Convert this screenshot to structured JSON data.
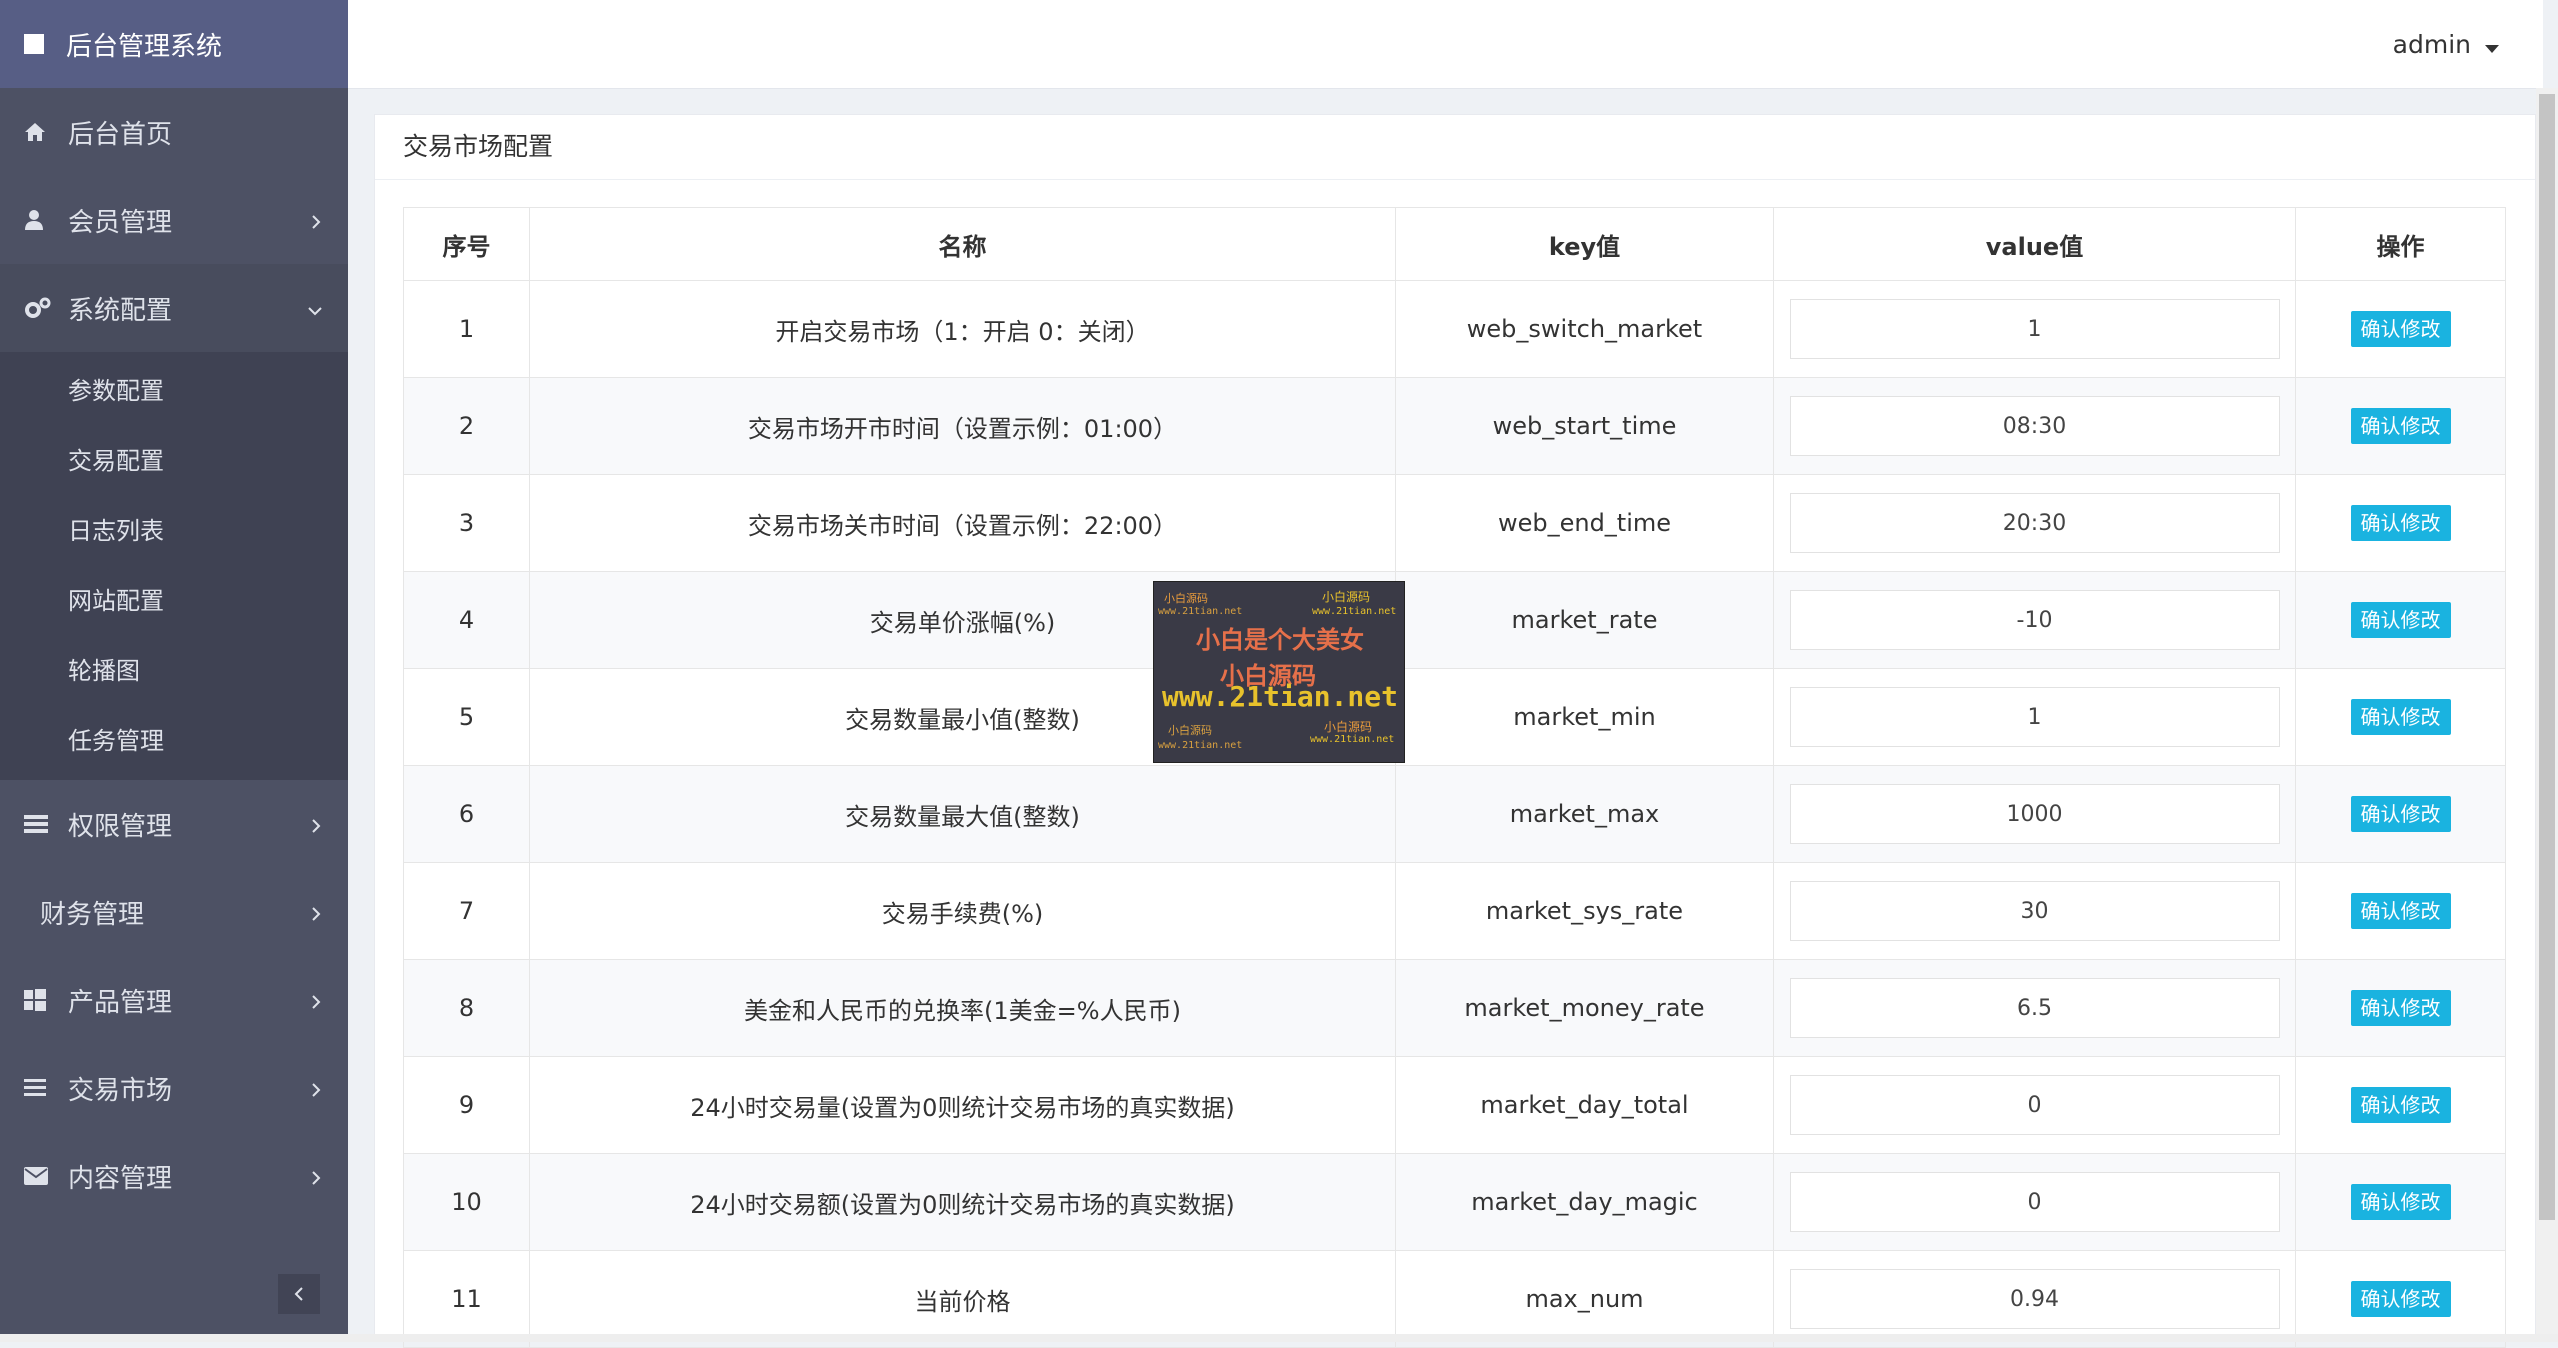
{
  "app": {
    "title": "后台管理系统"
  },
  "user": {
    "name": "admin"
  },
  "sidebar": {
    "items": [
      {
        "label": "后台首页",
        "icon": "home-icon"
      },
      {
        "label": "会员管理",
        "icon": "user-icon"
      },
      {
        "label": "系统配置",
        "icon": "gears-icon",
        "expanded": true,
        "children": [
          "参数配置",
          "交易配置",
          "日志列表",
          "网站配置",
          "轮播图",
          "任务管理"
        ]
      },
      {
        "label": "权限管理",
        "icon": "tasks-icon"
      },
      {
        "label": "财务管理",
        "icon": ""
      },
      {
        "label": "产品管理",
        "icon": "windows-icon"
      },
      {
        "label": "交易市场",
        "icon": "list-icon"
      },
      {
        "label": "内容管理",
        "icon": "envelope-icon"
      }
    ]
  },
  "panel": {
    "title": "交易市场配置"
  },
  "table": {
    "headers": [
      "序号",
      "名称",
      "key值",
      "value值",
      "操作"
    ],
    "action_label": "确认修改",
    "rows": [
      {
        "no": "1",
        "name": "开启交易市场（1：开启 0：关闭）",
        "key": "web_switch_market",
        "value": "1"
      },
      {
        "no": "2",
        "name": "交易市场开市时间（设置示例：01:00）",
        "key": "web_start_time",
        "value": "08:30"
      },
      {
        "no": "3",
        "name": "交易市场关市时间（设置示例：22:00）",
        "key": "web_end_time",
        "value": "20:30"
      },
      {
        "no": "4",
        "name": "交易单价涨幅(%)",
        "key": "market_rate",
        "value": "-10"
      },
      {
        "no": "5",
        "name": "交易数量最小值(整数)",
        "key": "market_min",
        "value": "1"
      },
      {
        "no": "6",
        "name": "交易数量最大值(整数)",
        "key": "market_max",
        "value": "1000"
      },
      {
        "no": "7",
        "name": "交易手续费(%)",
        "key": "market_sys_rate",
        "value": "30"
      },
      {
        "no": "8",
        "name": "美金和人民币的兑换率(1美金=%人民币)",
        "key": "market_money_rate",
        "value": "6.5"
      },
      {
        "no": "9",
        "name": "24小时交易量(设置为0则统计交易市场的真实数据)",
        "key": "market_day_total",
        "value": "0"
      },
      {
        "no": "10",
        "name": "24小时交易额(设置为0则统计交易市场的真实数据)",
        "key": "market_day_magic",
        "value": "0"
      },
      {
        "no": "11",
        "name": "当前价格",
        "key": "max_num",
        "value": "0.94"
      }
    ]
  },
  "watermark": {
    "line1a": "小白源码",
    "line1b": "小白源码",
    "line2a": "www.21tian.net",
    "line2b": "www.21tian.net",
    "line3": "小白是个大美女",
    "line4": "小白源码",
    "line5": "www.21tian.net",
    "line6a": "小白源码",
    "line6b": "小白源码",
    "line7a": "www.21tian.net",
    "line7b": "www.21tian.net"
  },
  "colors": {
    "sidebar": "#4d5164",
    "brand": "#575e85",
    "accent_button": "#1ab3e0"
  }
}
